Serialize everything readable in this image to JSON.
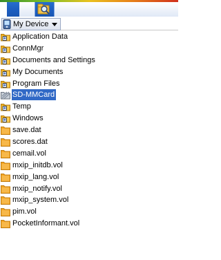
{
  "toolbar": {
    "find_icon": "search-folder-icon"
  },
  "location": {
    "label": "My Device"
  },
  "items": [
    {
      "name": "Application Data",
      "icon": "system-folder-icon",
      "selected": false
    },
    {
      "name": "ConnMgr",
      "icon": "system-folder-icon",
      "selected": false
    },
    {
      "name": "Documents and Settings",
      "icon": "system-folder-icon",
      "selected": false
    },
    {
      "name": "My Documents",
      "icon": "system-folder-icon",
      "selected": false
    },
    {
      "name": "Program Files",
      "icon": "system-folder-icon",
      "selected": false
    },
    {
      "name": "SD-MMCard",
      "icon": "storage-card-icon",
      "selected": true
    },
    {
      "name": "Temp",
      "icon": "system-folder-icon",
      "selected": false
    },
    {
      "name": "Windows",
      "icon": "system-folder-icon",
      "selected": false
    },
    {
      "name": "save.dat",
      "icon": "file-icon",
      "selected": false
    },
    {
      "name": "scores.dat",
      "icon": "file-icon",
      "selected": false
    },
    {
      "name": "cemail.vol",
      "icon": "file-icon",
      "selected": false
    },
    {
      "name": "mxip_initdb.vol",
      "icon": "file-icon",
      "selected": false
    },
    {
      "name": "mxip_lang.vol",
      "icon": "file-icon",
      "selected": false
    },
    {
      "name": "mxip_notify.vol",
      "icon": "file-icon",
      "selected": false
    },
    {
      "name": "mxip_system.vol",
      "icon": "file-icon",
      "selected": false
    },
    {
      "name": "pim.vol",
      "icon": "file-icon",
      "selected": false
    },
    {
      "name": "PocketInformant.vol",
      "icon": "file-icon",
      "selected": false
    }
  ],
  "colors": {
    "toolbar": "#1d5ec0",
    "selection": "#3169c6",
    "folder": "#f5b41f"
  }
}
